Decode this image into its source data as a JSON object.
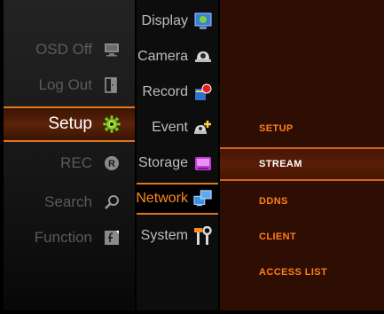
{
  "main_menu": {
    "items": [
      {
        "label": "OSD Off",
        "icon": "monitor-icon"
      },
      {
        "label": "Log Out",
        "icon": "logout-door-icon"
      },
      {
        "label": "Setup",
        "icon": "gear-icon",
        "active": true
      },
      {
        "label": "REC",
        "icon": "rec-icon"
      },
      {
        "label": "Search",
        "icon": "magnifier-icon"
      },
      {
        "label": "Function",
        "icon": "function-icon"
      }
    ]
  },
  "setup_menu": {
    "items": [
      {
        "label": "Display",
        "icon": "display-icon"
      },
      {
        "label": "Camera",
        "icon": "camera-dome-icon"
      },
      {
        "label": "Record",
        "icon": "record-icon"
      },
      {
        "label": "Event",
        "icon": "event-icon"
      },
      {
        "label": "Storage",
        "icon": "storage-icon"
      },
      {
        "label": "Network",
        "icon": "network-icon",
        "active": true
      },
      {
        "label": "System",
        "icon": "tools-icon"
      }
    ]
  },
  "network_menu": {
    "items": [
      {
        "label": "SETUP"
      },
      {
        "label": "STREAM",
        "active": true
      },
      {
        "label": "DDNS"
      },
      {
        "label": "CLIENT"
      },
      {
        "label": "ACCESS LIST"
      }
    ]
  },
  "colors": {
    "accent": "#e0761e",
    "submenu_text": "#ff7f1a",
    "panel_bg": "#2e0d03"
  }
}
